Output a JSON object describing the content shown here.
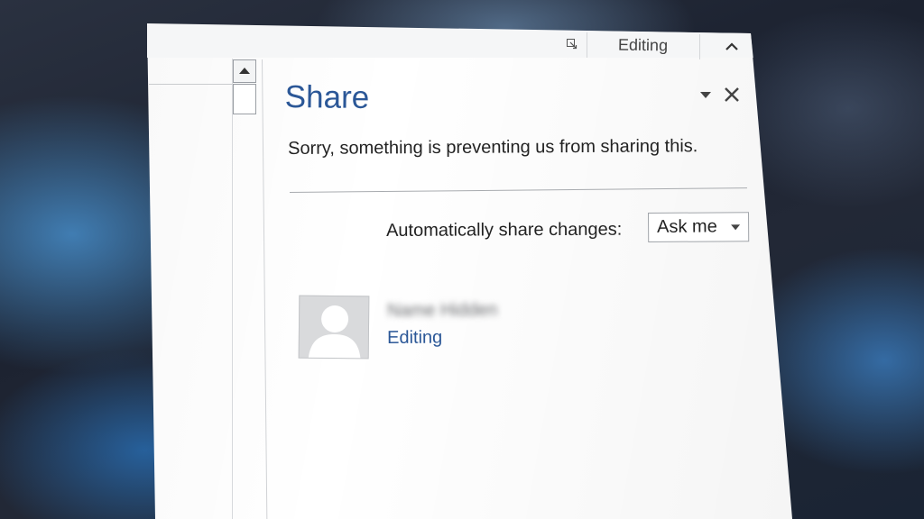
{
  "ribbon": {
    "editing_label": "Editing"
  },
  "share_pane": {
    "title": "Share",
    "error_message": "Sorry, something is preventing us from sharing this.",
    "auto_share": {
      "label": "Automatically share changes:",
      "selected_value": "Ask me"
    },
    "user": {
      "name": "Name Hidden",
      "permission": "Editing"
    }
  },
  "colors": {
    "accent": "#2b5797",
    "text": "#222222",
    "window_bg": "#ffffff"
  },
  "icons": {
    "dialog_launcher": "dialog-launcher-icon",
    "collapse_ribbon": "chevron-up-icon",
    "scroll_up": "triangle-up-icon",
    "pane_options": "triangle-down-icon",
    "close": "close-icon",
    "select_arrow": "triangle-down-icon",
    "avatar": "person-silhouette-icon"
  }
}
